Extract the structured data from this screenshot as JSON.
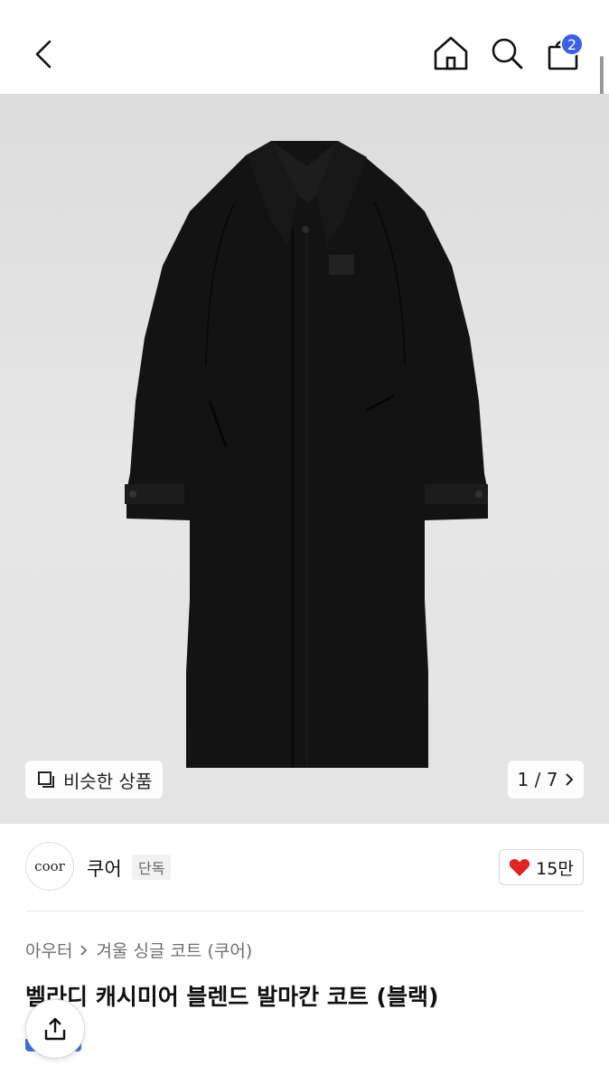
{
  "header": {
    "cart_count": "2",
    "icons": [
      "back-icon",
      "home-icon",
      "search-icon",
      "cart-icon"
    ]
  },
  "hero": {
    "similar_label": "비슷한 상품",
    "page_indicator": "1 / 7",
    "background_color": "#e3e3e3"
  },
  "brand": {
    "logo_text": "coor",
    "name": "쿠어",
    "badge": "단독",
    "likes": "15만",
    "heart_color": "#e02424"
  },
  "product": {
    "breadcrumb": [
      "아우터",
      "겨울 싱글 코트 (쿠어)"
    ],
    "title": "벨라디 캐시미어 블렌드 발마칸 코트 (블랙)"
  },
  "colors": {
    "accent": "#3d5ee8"
  }
}
